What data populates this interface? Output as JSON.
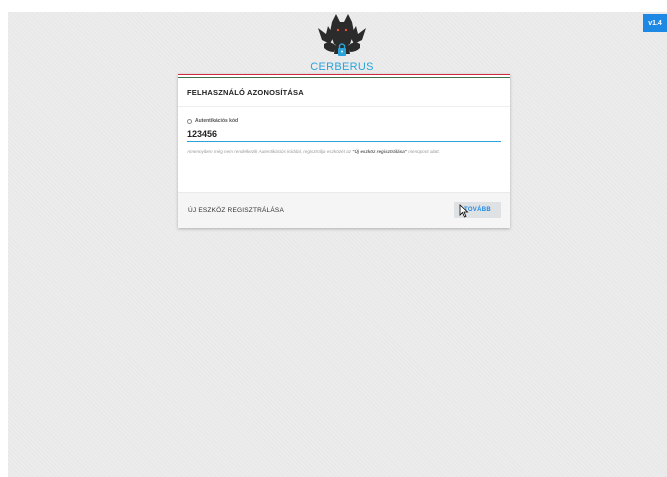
{
  "app": {
    "version": "v1.4",
    "brand": "CERBERUS",
    "logo_icon": "cerberus-logo-icon"
  },
  "card": {
    "title": "FELHASZNÁLÓ AZONOSÍTÁSA",
    "field_label": "Autentikációs kód",
    "code_value": "123456",
    "hint_prefix": "Amennyiben még nem rendelkezik Autentikációs kóddal, regisztrálja eszközét az ",
    "hint_link": "\"Új eszköz regisztrálása\"",
    "hint_suffix": " menüpont alatt.",
    "register_label": "ÚJ ESZKÖZ REGISZTRÁLÁSA",
    "next_label": "TOVÁBB"
  },
  "colors": {
    "accent": "#29a3da",
    "badge": "#1e88e5",
    "flag_red": "#cd2a3e",
    "flag_white": "#ffffff",
    "flag_green": "#436f4d"
  }
}
